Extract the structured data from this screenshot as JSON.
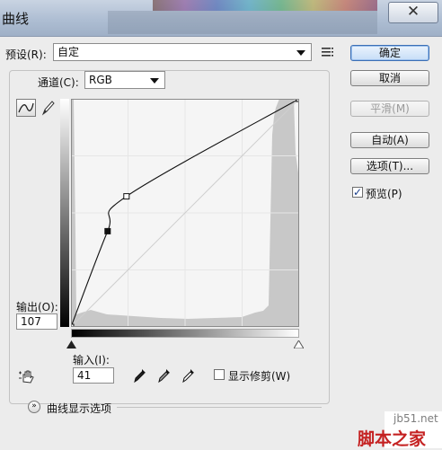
{
  "window": {
    "title": "曲线",
    "close": "✕"
  },
  "preset": {
    "label": "预设(R):",
    "value": "自定"
  },
  "channel": {
    "label": "通道(C):",
    "value": "RGB"
  },
  "buttons": {
    "ok": "确定",
    "cancel": "取消",
    "smooth": "平滑(M)",
    "auto": "自动(A)",
    "options": "选项(T)..."
  },
  "preview": {
    "label": "预览(P)",
    "checked": true
  },
  "output": {
    "label": "输出(O):",
    "value": "107"
  },
  "input": {
    "label": "输入(I):",
    "value": "41"
  },
  "clipping": {
    "label": "显示修剪(W)",
    "checked": false
  },
  "curve_options": {
    "label": "曲线显示选项"
  },
  "curve": {
    "points": [
      [
        0,
        0
      ],
      [
        41,
        107
      ],
      [
        62,
        146
      ],
      [
        255,
        255
      ]
    ]
  },
  "watermark": {
    "site": "jb51.net",
    "brand": "脚本之家"
  }
}
